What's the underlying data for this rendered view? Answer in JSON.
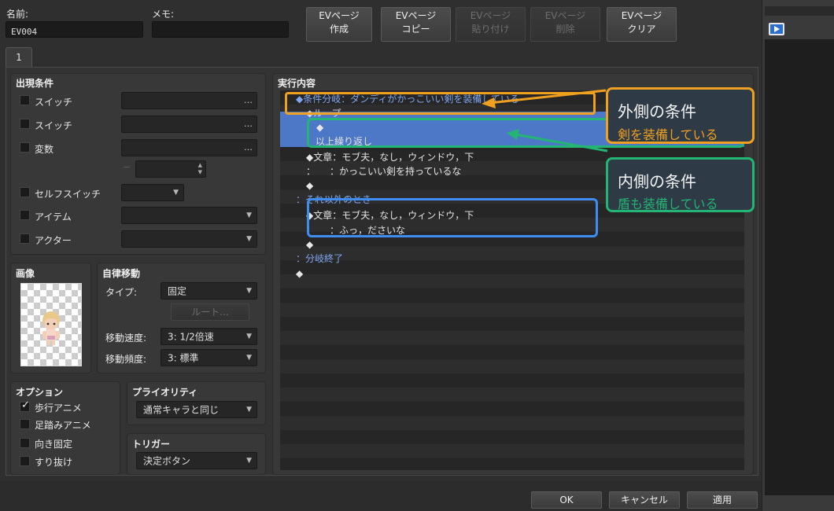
{
  "top": {
    "name_label": "名前:",
    "name_value": "EV004",
    "memo_label": "メモ:",
    "memo_value": "",
    "buttons": [
      {
        "line1": "EVページ",
        "line2": "作成",
        "enabled": true
      },
      {
        "line1": "EVページ",
        "line2": "コピー",
        "enabled": true
      },
      {
        "line1": "EVページ",
        "line2": "貼り付け",
        "enabled": false
      },
      {
        "line1": "EVページ",
        "line2": "削除",
        "enabled": false
      },
      {
        "line1": "EVページ",
        "line2": "クリア",
        "enabled": true
      }
    ]
  },
  "tabs": [
    {
      "label": "1"
    }
  ],
  "conditions": {
    "title": "出現条件",
    "switch1": "スイッチ",
    "switch2": "スイッチ",
    "variable": "変数",
    "self_switch": "セルフスイッチ",
    "item": "アイテム",
    "actor": "アクター",
    "ellipsis": "…"
  },
  "image": {
    "title": "画像"
  },
  "autonomous": {
    "title": "自律移動",
    "type_label": "タイプ:",
    "type_value": "固定",
    "route_button": "ルート...",
    "speed_label": "移動速度:",
    "speed_value": "3: 1/2倍速",
    "freq_label": "移動頻度:",
    "freq_value": "3: 標準"
  },
  "options": {
    "title": "オプション",
    "items": [
      {
        "label": "歩行アニメ",
        "checked": true
      },
      {
        "label": "足踏みアニメ",
        "checked": false
      },
      {
        "label": "向き固定",
        "checked": false
      },
      {
        "label": "すり抜け",
        "checked": false
      }
    ]
  },
  "priority": {
    "title": "プライオリティ",
    "value": "通常キャラと同じ"
  },
  "trigger": {
    "title": "トリガー",
    "value": "決定ボタン"
  },
  "contents": {
    "title": "実行内容",
    "lines": [
      "◆条件分岐：ダンディがかっこいい剣を装備している",
      "◆ループ",
      "◆",
      "：以上繰り返し",
      "◆文章：モブ夫，なし，ウィンドウ，下",
      "：　　：かっこいい剣を持っているな",
      "◆",
      "：それ以外のとき",
      "◆文章：モブ夫，なし，ウィンドウ，下",
      "：　　：ふっ，ださいな",
      "◆",
      "：分岐終了",
      "◆"
    ]
  },
  "callouts": {
    "outer": {
      "title": "外側の条件",
      "sub": "剣を装備している",
      "color": "#f0a020"
    },
    "inner": {
      "title": "内側の条件",
      "sub": "盾も装備している",
      "color": "#22b573"
    },
    "blue_color": "#3d8ef0"
  },
  "footer": {
    "ok": "OK",
    "cancel": "キャンセル",
    "apply": "適用"
  },
  "side": {
    "play_icon": "play-icon"
  }
}
